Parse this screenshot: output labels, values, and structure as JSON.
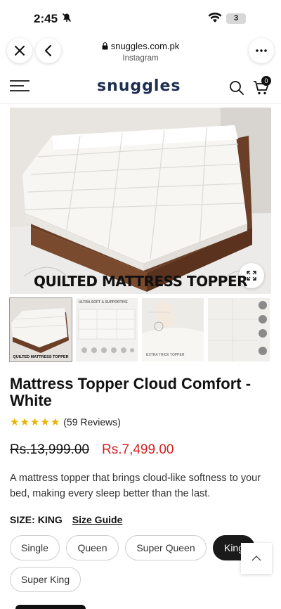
{
  "status": {
    "time": "2:45",
    "battery": "3"
  },
  "browser": {
    "url": "snuggles.com.pk",
    "source": "Instagram"
  },
  "site": {
    "logo": "snuggles",
    "cart_count": "0"
  },
  "gallery": {
    "hero_caption": "QUILTED MATTRESS TOPPER",
    "thumbs": [
      {
        "label": "QUILTED MATTRESS TOPPER"
      },
      {
        "top_label": "ULTRA SOFT & SUPPORTIVE"
      },
      {
        "caption": "EXTRA THICK TOPPER"
      },
      {
        "label": ""
      }
    ]
  },
  "product": {
    "title": "Mattress Topper Cloud Comfort - White",
    "rating": 5,
    "reviews": "(59 Reviews)",
    "price_old": "Rs.13,999.00",
    "price_new": "Rs.7,499.00",
    "description": "A mattress topper that brings cloud-like softness to your bed, making every sleep better than the last.",
    "size_label": "SIZE:",
    "size_value": "KING",
    "size_guide": "Size Guide",
    "sizes": [
      "Single",
      "Queen",
      "Super Queen",
      "King",
      "Super King"
    ],
    "selected_size": "King"
  },
  "colors": {
    "price_sale": "#d41f1f",
    "star": "#e6b400",
    "logo": "#1d2e4f"
  }
}
